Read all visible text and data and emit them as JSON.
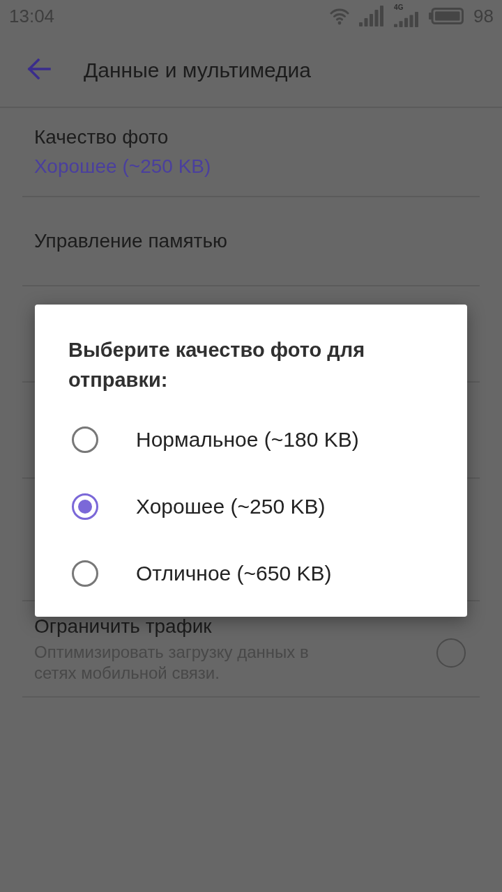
{
  "status_bar": {
    "time": "13:04",
    "network_type": "4G",
    "battery_percent": "98"
  },
  "toolbar": {
    "title": "Данные и мультимедиа"
  },
  "settings_top": [
    {
      "kind": "value",
      "title": "Качество фото",
      "value": "Хорошее (~250 KB)"
    },
    {
      "kind": "plain",
      "title": "Управление памятью"
    }
  ],
  "settings_bottom": [
    {
      "kind": "checkbox",
      "title": "Ограничить трафик",
      "summary": "Оптимизировать загрузку данных в сетях мобильной связи.",
      "checked": false
    }
  ],
  "dialog": {
    "title": "Выберите качество фото для отправки:",
    "options": [
      {
        "label": "Нормальное (~180 KB)",
        "selected": false
      },
      {
        "label": "Хорошее (~250 KB)",
        "selected": true
      },
      {
        "label": "Отличное (~650 KB)",
        "selected": false
      }
    ]
  }
}
